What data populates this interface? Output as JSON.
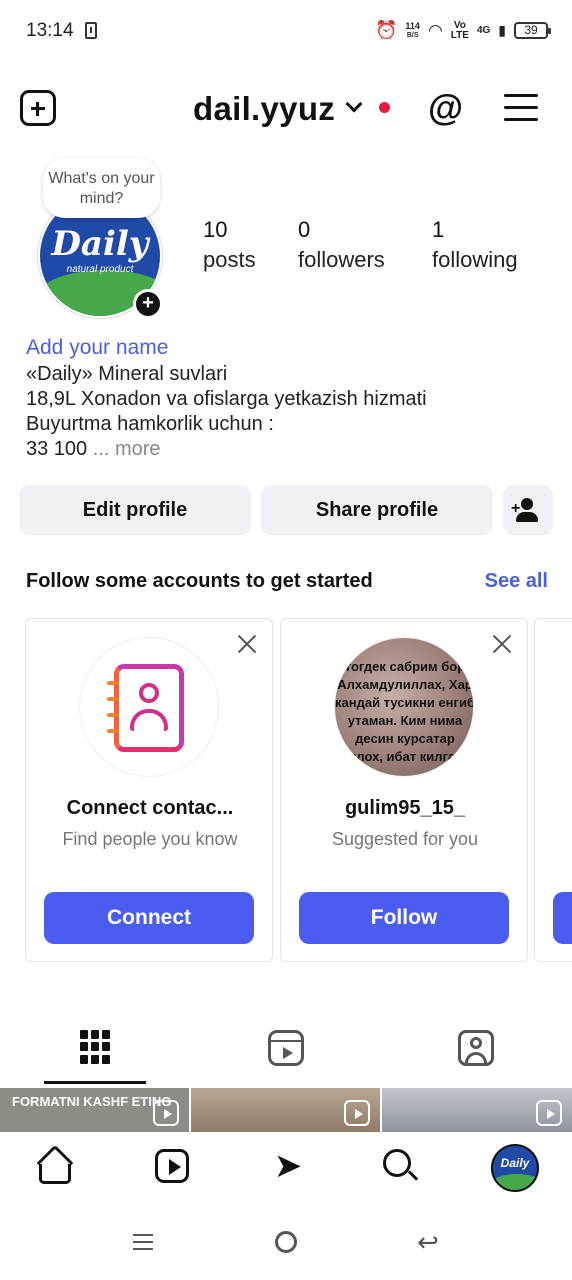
{
  "status_bar": {
    "time": "13:14",
    "speed_value": "114",
    "speed_unit": "B/S",
    "volte_top": "Vo",
    "volte_bottom": "LTE",
    "network": "4G",
    "battery": "39"
  },
  "header": {
    "username": "dail.yyuz",
    "notification_dot_color": "#e8193c"
  },
  "profile": {
    "bubble_text": "What's on your mind?",
    "avatar_logo": "Daily",
    "avatar_sub": "natural product",
    "stats": [
      {
        "value": "10",
        "label": "posts"
      },
      {
        "value": "0",
        "label": "followers"
      },
      {
        "value": "1",
        "label": "following"
      }
    ],
    "add_name": "Add your name",
    "bio": [
      "«Daily» Mineral suvlari",
      "18,9L Xonadon va ofislarga yetkazish hizmati",
      "Buyurtma hamkorlik uchun :",
      "33 100"
    ],
    "more": "... more"
  },
  "actions": {
    "edit_profile": "Edit profile",
    "share_profile": "Share profile"
  },
  "suggestions": {
    "title": "Follow some accounts to get started",
    "see_all": "See all",
    "cards": [
      {
        "name": "Connect contac...",
        "subtitle": "Find people you know",
        "button": "Connect"
      },
      {
        "name": "gulim95_15_",
        "subtitle": "Suggested for you",
        "button": "Follow",
        "image_text": "тогдек сабрим бор Алхамдулиллах, Хар кандай тусикни енгиб утаман. Ким нима десин курсатар Аллох, ибат килганл"
      }
    ]
  },
  "thumbnails": [
    {
      "text": "FORMATNI KASHF ETING"
    },
    {
      "text": ""
    },
    {
      "text": ""
    }
  ],
  "colors": {
    "accent": "#4a5df0",
    "link": "#4b5fe0",
    "button_bg": "#eff1f4"
  }
}
